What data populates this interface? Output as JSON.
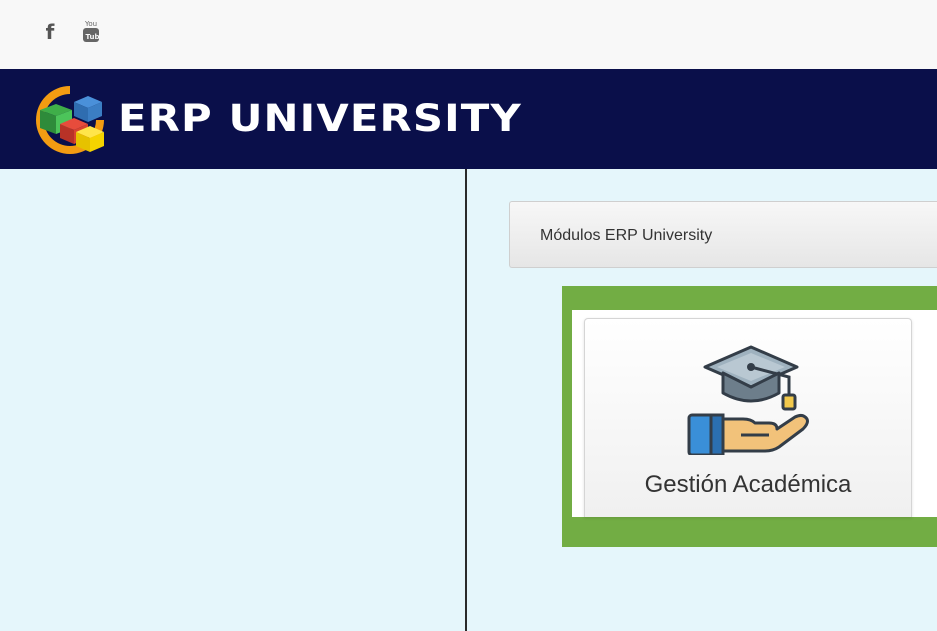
{
  "topbar": {
    "facebook_glyph": "f",
    "youtube_icon": "youtube-icon"
  },
  "header": {
    "brand": "ERP UNIVERSITY",
    "logo_icon": "cubes-logo-icon",
    "background": "#0a0f4a"
  },
  "main": {
    "modules_title": "Módulos ERP University",
    "highlight_color": "#72ad44",
    "modules": [
      {
        "label": "Gestión Académica",
        "icon": "graduation-cap-hand-icon"
      }
    ]
  },
  "colors": {
    "sidebar": "#e5f6fb",
    "accent_green": "#72ad44"
  }
}
